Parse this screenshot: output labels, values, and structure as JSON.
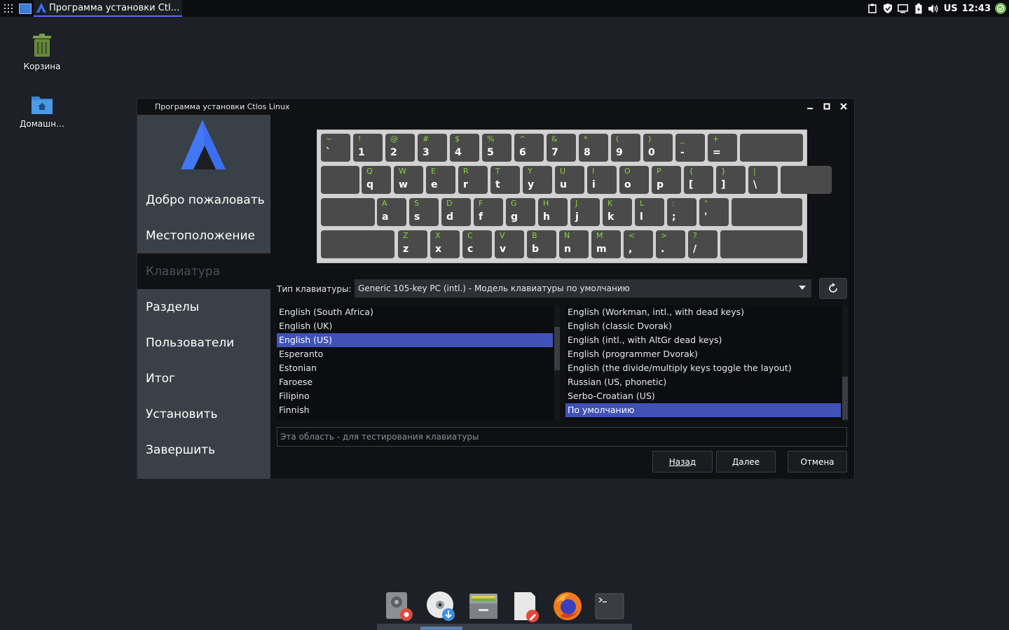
{
  "topbar": {
    "task_title": "Программа установки Ctl…",
    "lang": "US",
    "clock": "12:43"
  },
  "desktop": {
    "icons": [
      {
        "label": "Корзина",
        "icon": "trash-icon"
      },
      {
        "label": "Домашн…",
        "icon": "home-folder-icon"
      }
    ]
  },
  "window": {
    "title": "Программа установки Ctlos Linux",
    "sidebar": {
      "items": [
        {
          "label": "Добро пожаловать",
          "state": "done"
        },
        {
          "label": "Местоположение",
          "state": "done"
        },
        {
          "label": "Клавиатура",
          "state": "current"
        },
        {
          "label": "Разделы",
          "state": "pending"
        },
        {
          "label": "Пользователи",
          "state": "pending"
        },
        {
          "label": "Итог",
          "state": "pending"
        },
        {
          "label": "Установить",
          "state": "pending"
        },
        {
          "label": "Завершить",
          "state": "pending"
        }
      ]
    },
    "keyboard": {
      "rows": [
        [
          [
            "~",
            "`"
          ],
          [
            "!",
            "1"
          ],
          [
            "@",
            "2"
          ],
          [
            "#",
            "3"
          ],
          [
            "$",
            "4"
          ],
          [
            "%",
            "5"
          ],
          [
            "^",
            "6"
          ],
          [
            "&",
            "7"
          ],
          [
            "*",
            "8"
          ],
          [
            "(",
            "9"
          ],
          [
            ")",
            "0"
          ],
          [
            "_",
            "-"
          ],
          [
            "+",
            "="
          ]
        ],
        [
          [
            "Q",
            "q"
          ],
          [
            "W",
            "w"
          ],
          [
            "E",
            "e"
          ],
          [
            "R",
            "r"
          ],
          [
            "T",
            "t"
          ],
          [
            "Y",
            "y"
          ],
          [
            "U",
            "u"
          ],
          [
            "I",
            "i"
          ],
          [
            "O",
            "o"
          ],
          [
            "P",
            "p"
          ],
          [
            "{",
            "["
          ],
          [
            "}",
            "]"
          ],
          [
            "|",
            "\\"
          ]
        ],
        [
          [
            "A",
            "a"
          ],
          [
            "S",
            "s"
          ],
          [
            "D",
            "d"
          ],
          [
            "F",
            "f"
          ],
          [
            "G",
            "g"
          ],
          [
            "H",
            "h"
          ],
          [
            "J",
            "j"
          ],
          [
            "K",
            "k"
          ],
          [
            "L",
            "l"
          ],
          [
            ":",
            ";"
          ],
          [
            "\"",
            "'"
          ]
        ],
        [
          [
            "Z",
            "z"
          ],
          [
            "X",
            "x"
          ],
          [
            "C",
            "c"
          ],
          [
            "V",
            "v"
          ],
          [
            "B",
            "b"
          ],
          [
            "N",
            "n"
          ],
          [
            "M",
            "m"
          ],
          [
            "<",
            ","
          ],
          [
            ">",
            "."
          ],
          [
            "?",
            "/"
          ]
        ]
      ]
    },
    "model": {
      "label": "Тип клавиатуры:",
      "value": "Generic 105-key PC (intl.)  -  Модель клавиатуры по умолчанию"
    },
    "layouts": {
      "items": [
        "English (South Africa)",
        "English (UK)",
        "English (US)",
        "Esperanto",
        "Estonian",
        "Faroese",
        "Filipino",
        "Finnish"
      ],
      "selected": "English (US)",
      "scroll_position": 0.3
    },
    "variants": {
      "items": [
        "English (Workman, intl., with dead keys)",
        "English (classic Dvorak)",
        "English (intl., with AltGr dead keys)",
        "English (programmer Dvorak)",
        "English (the divide/multiply keys toggle the layout)",
        "Russian (US, phonetic)",
        "Serbo-Croatian (US)",
        "По умолчанию"
      ],
      "selected": "По умолчанию",
      "scroll_position": 1.0
    },
    "test_placeholder": "Эта область - для тестирования клавиатуры",
    "buttons": {
      "back": "Назад",
      "next": "Далее",
      "cancel": "Отмена"
    }
  },
  "dock": {
    "items": [
      "disk-settings-icon",
      "disc-download-icon",
      "file-manager-icon",
      "text-editor-icon",
      "firefox-icon",
      "terminal-icon"
    ]
  },
  "colors": {
    "accent": "#4052b8",
    "key_legend": "#8ad23c",
    "sidebar": "#3a4047",
    "logo_blue": "#3b6ff0"
  }
}
